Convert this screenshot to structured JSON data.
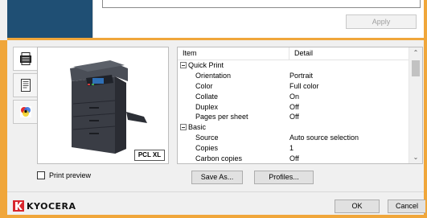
{
  "top": {
    "apply_label": "Apply"
  },
  "tabs": [
    {
      "icon": "printer-settings-icon"
    },
    {
      "icon": "document-icon"
    },
    {
      "icon": "color-icon"
    }
  ],
  "preview": {
    "badge": "PCL XL",
    "print_preview_label": "Print preview"
  },
  "table": {
    "headers": {
      "item": "Item",
      "detail": "Detail"
    },
    "rows": [
      {
        "type": "group",
        "item": "Quick Print",
        "detail": ""
      },
      {
        "type": "item",
        "item": "Orientation",
        "detail": "Portrait"
      },
      {
        "type": "item",
        "item": "Color",
        "detail": "Full color"
      },
      {
        "type": "item",
        "item": "Collate",
        "detail": "On"
      },
      {
        "type": "item",
        "item": "Duplex",
        "detail": "Off"
      },
      {
        "type": "item",
        "item": "Pages per sheet",
        "detail": "Off"
      },
      {
        "type": "group",
        "item": "Basic",
        "detail": ""
      },
      {
        "type": "item",
        "item": "Source",
        "detail": "Auto source selection"
      },
      {
        "type": "item",
        "item": "Copies",
        "detail": "1"
      },
      {
        "type": "item",
        "item": "Carbon copies",
        "detail": "Off"
      }
    ]
  },
  "buttons": {
    "save_as": "Save As...",
    "profiles": "Profiles...",
    "ok": "OK",
    "cancel": "Cancel"
  },
  "brand": {
    "name": "KYOCERA",
    "color": "#d8262d"
  }
}
